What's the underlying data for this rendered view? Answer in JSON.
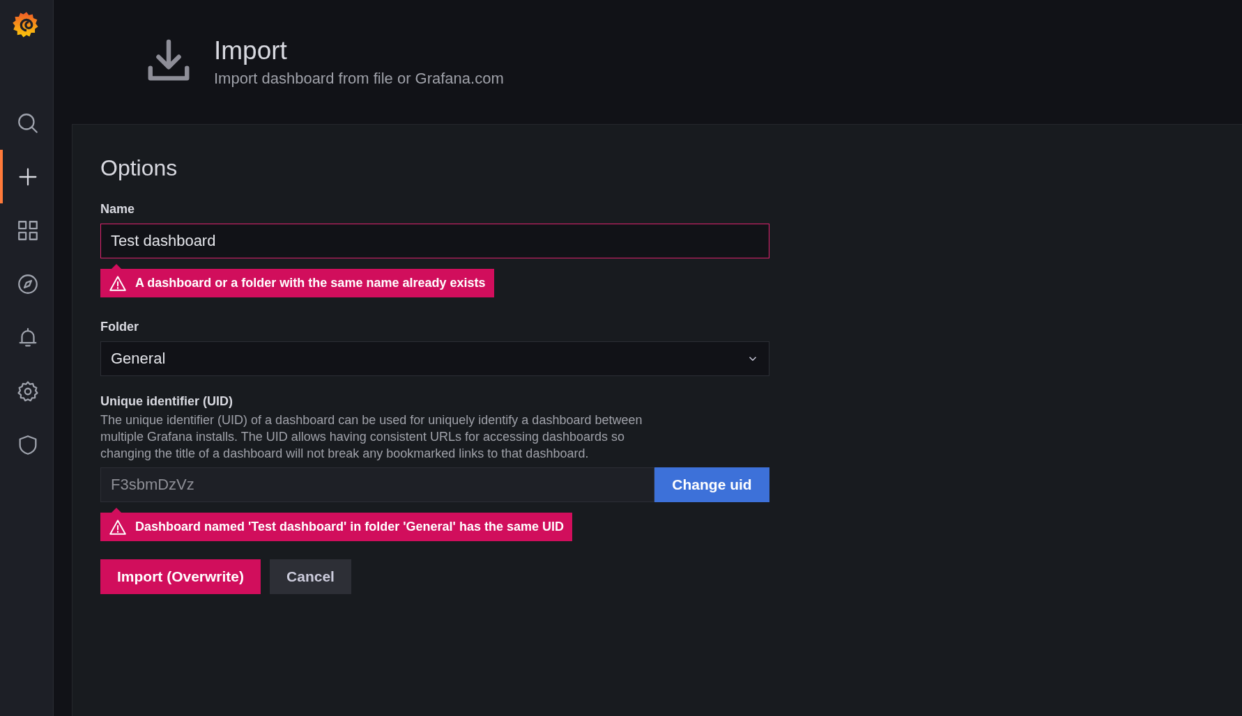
{
  "sidebar": {
    "items": [
      {
        "kind": "search",
        "selected": false
      },
      {
        "kind": "create",
        "selected": true
      },
      {
        "kind": "dashboards",
        "selected": false
      },
      {
        "kind": "explore",
        "selected": false
      },
      {
        "kind": "alerting",
        "selected": false
      },
      {
        "kind": "configuration",
        "selected": false
      },
      {
        "kind": "shield",
        "selected": false
      }
    ]
  },
  "header": {
    "title": "Import",
    "subtitle": "Import dashboard from file or Grafana.com"
  },
  "options": {
    "heading": "Options",
    "name": {
      "label": "Name",
      "value": "Test dashboard",
      "invalid": true,
      "error": "A dashboard or a folder with the same name already exists"
    },
    "folder": {
      "label": "Folder",
      "value": "General"
    },
    "uid": {
      "label": "Unique identifier (UID)",
      "description": "The unique identifier (UID) of a dashboard can be used for uniquely identify a dashboard between multiple Grafana installs. The UID allows having consistent URLs for accessing dashboards so changing the title of a dashboard will not break any bookmarked links to that dashboard.",
      "value": "F3sbmDzVz",
      "disabled": true,
      "button": "Change uid",
      "error": "Dashboard named 'Test dashboard' in folder 'General' has the same UID"
    },
    "buttons": [
      {
        "label": "Import (Overwrite)",
        "kind": "destructive"
      },
      {
        "label": "Cancel",
        "kind": "secondary"
      }
    ]
  }
}
